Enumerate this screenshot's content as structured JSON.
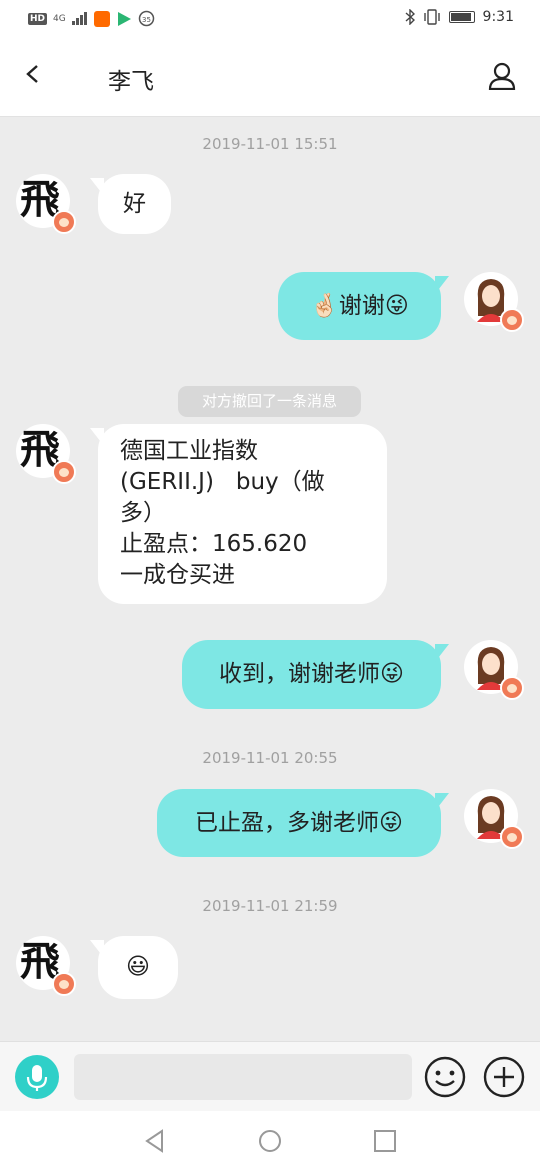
{
  "status_bar": {
    "left_chips": [
      "HD",
      "4G"
    ],
    "time": "9:31",
    "icons": [
      "bluetooth-icon",
      "vibrate-icon",
      "battery-icon"
    ]
  },
  "header": {
    "title": "李飞",
    "back_icon": "chevron-left-icon",
    "profile_icon": "person-icon"
  },
  "messages": {
    "ts1": "2019-11-01 15:51",
    "m1": "好",
    "m2": "🤞🏻谢谢😜",
    "recall": "对方撤回了一条消息",
    "m3_line1": "德国工业指数",
    "m3_line2": "(GERII.J)   buy（做",
    "m3_line3": "多）",
    "m3_line4": "止盈点：165.620",
    "m3_line5": "一成仓买进",
    "m4": "收到，谢谢老师😜",
    "ts2": "2019-11-01 20:55",
    "m5": "已止盈，多谢老师😜",
    "ts3": "2019-11-01 21:59",
    "m6": "😃"
  },
  "contact_avatar_char": "飛",
  "input_bar": {
    "placeholder": "",
    "icons": [
      "microphone-icon",
      "emoji-icon",
      "plus-icon"
    ]
  },
  "colors": {
    "accent": "#2fd0c8",
    "outgoing_bubble": "#7ee7e4",
    "incoming_bubble": "#ffffff",
    "chat_bg": "#ececec",
    "badge": "#f07a56"
  },
  "nav_bar": {
    "icons": [
      "nav-back-icon",
      "nav-home-icon",
      "nav-recent-icon"
    ]
  }
}
